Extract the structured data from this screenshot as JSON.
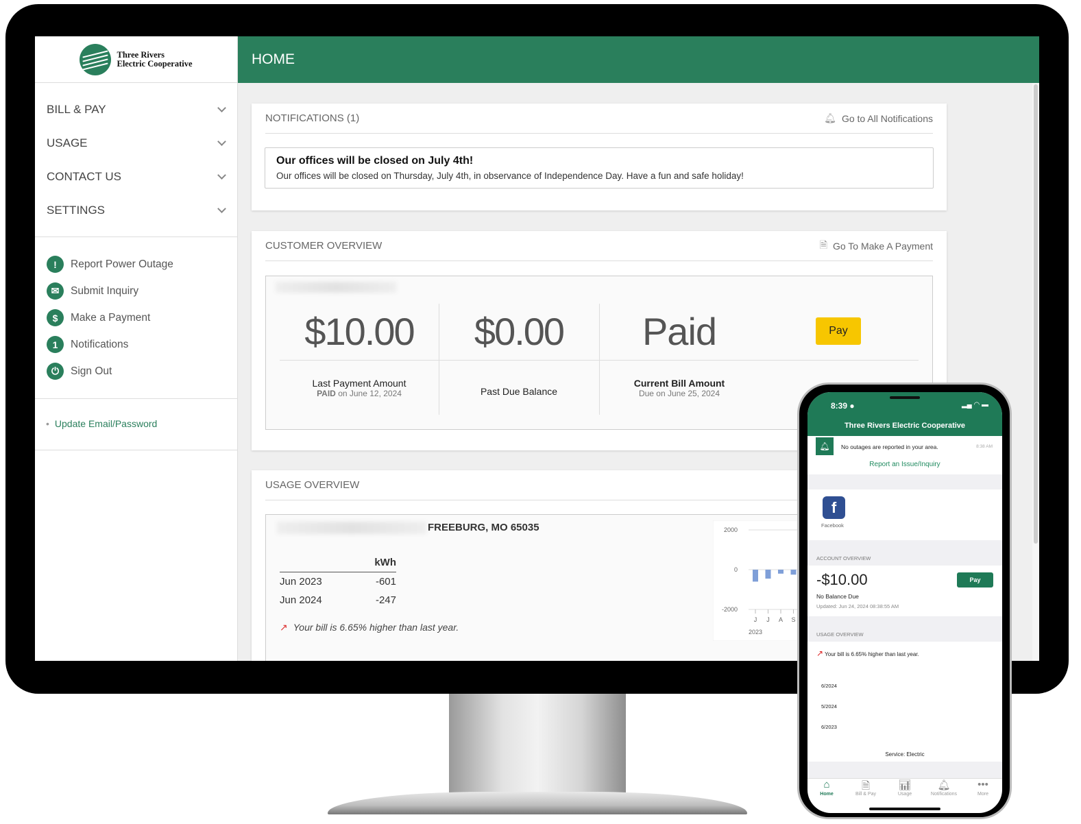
{
  "brand": {
    "name_line1": "Three Rivers",
    "name_line2": "Electric Cooperative",
    "color": "#2a7f5c"
  },
  "header": {
    "title": "HOME"
  },
  "sidebar": {
    "nav": [
      {
        "label": "BILL & PAY"
      },
      {
        "label": "USAGE"
      },
      {
        "label": "CONTACT US"
      },
      {
        "label": "SETTINGS"
      }
    ],
    "quick": [
      {
        "label": "Report Power Outage",
        "icon": "!"
      },
      {
        "label": "Submit Inquiry",
        "icon": "✉"
      },
      {
        "label": "Make a Payment",
        "icon": "$"
      },
      {
        "label": "Notifications",
        "icon": "1"
      },
      {
        "label": "Sign Out",
        "icon": "⏻"
      }
    ],
    "account_link": "Update Email/Password"
  },
  "notifications": {
    "title": "NOTIFICATIONS (1)",
    "link": "Go to All Notifications",
    "item_title": "Our offices will be closed on July 4th!",
    "item_body": "Our offices will be closed on Thursday, July 4th, in observance of Independence Day. Have a fun and safe holiday!"
  },
  "customer_overview": {
    "title": "CUSTOMER OVERVIEW",
    "link": "Go To Make A Payment",
    "last_payment": {
      "value": "$10.00",
      "label": "Last Payment Amount",
      "status": "PAID",
      "date": "on June 12, 2024"
    },
    "past_due": {
      "value": "$0.00",
      "label": "Past Due Balance"
    },
    "current_bill": {
      "value": "Paid",
      "label": "Current Bill Amount",
      "due": "Due on June 25, 2024"
    },
    "pay_label": "Pay",
    "pay_color": "#f7c600"
  },
  "usage_overview": {
    "title": "USAGE OVERVIEW",
    "address": "FREEBURG, MO 65035",
    "unit": "kWh",
    "rows": [
      {
        "period": "Jun 2023",
        "value": "-601"
      },
      {
        "period": "Jun 2024",
        "value": "-247"
      }
    ],
    "message": "Your bill is 6.65% higher than last year."
  },
  "chart_data": {
    "type": "bar",
    "yticks": [
      "2000",
      "0",
      "-2000"
    ],
    "ylim": [
      -2000,
      2000
    ],
    "categories": [
      "J",
      "J",
      "A",
      "S"
    ],
    "year": "2023",
    "values": [
      -601,
      -450,
      -200,
      -250
    ]
  },
  "phone": {
    "time": "8:39",
    "app_title": "Three Rivers Electric Cooperative",
    "outage_msg": "No outages are reported in your area.",
    "outage_time": "8:38 AM",
    "report_link": "Report an Issue/Inquiry",
    "facebook": "Facebook",
    "account_title": "ACCOUNT OVERVIEW",
    "balance": "-$10.00",
    "balance_label": "No Balance Due",
    "updated": "Updated: Jun 24, 2024 08:38:55 AM",
    "pay": "Pay",
    "usage_title": "USAGE OVERVIEW",
    "usage_msg": "Your bill is 6.65% higher than last year.",
    "periods": [
      "6/2024",
      "5/2024",
      "6/2023"
    ],
    "service": "Service: Electric",
    "tabs": [
      {
        "label": "Home",
        "icon": "home"
      },
      {
        "label": "Bill & Pay",
        "icon": "bill"
      },
      {
        "label": "Usage",
        "icon": "chart"
      },
      {
        "label": "Notifications",
        "icon": "bell"
      },
      {
        "label": "More",
        "icon": "more"
      }
    ]
  }
}
